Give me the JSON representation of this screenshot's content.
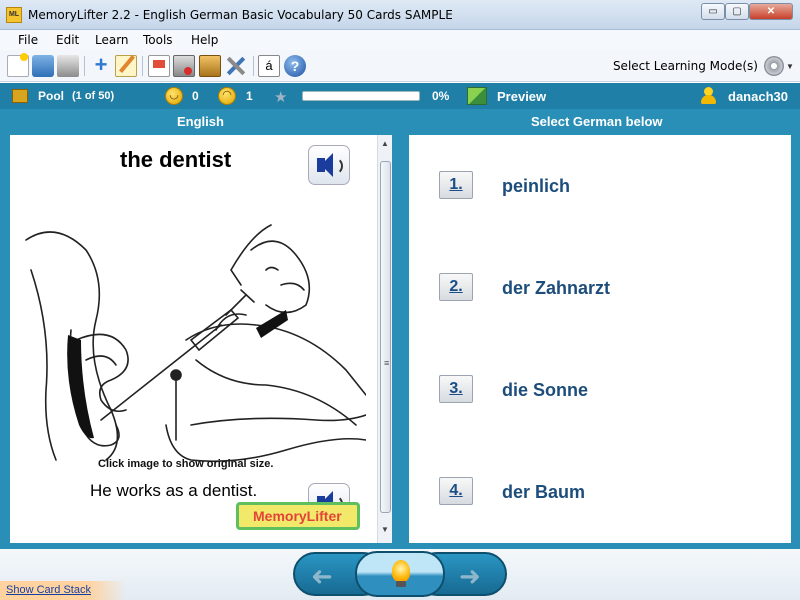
{
  "window": {
    "icon_text": "ML",
    "title": "MemoryLifter 2.2 - English German Basic Vocabulary 50 Cards SAMPLE",
    "buttons": {
      "minimize": "▭",
      "maximize": "▢",
      "close": "✕"
    }
  },
  "menu": {
    "items": [
      "File",
      "Edit",
      "Learn",
      "Tools",
      "Help"
    ]
  },
  "toolbar": {
    "buttons": [
      {
        "icon": "new-document-icon"
      },
      {
        "icon": "open-folder-icon"
      },
      {
        "icon": "print-icon"
      },
      {
        "icon": "add-card-icon"
      },
      {
        "icon": "edit-card-icon"
      },
      {
        "icon": "presentation-icon"
      },
      {
        "icon": "card-stack-icon"
      },
      {
        "icon": "dictionary-icon"
      },
      {
        "icon": "tools-icon"
      },
      {
        "icon": "special-character-icon",
        "label": "á"
      },
      {
        "icon": "help-icon",
        "label": "?"
      }
    ],
    "learning_mode_label": "Select Learning Mode(s)"
  },
  "status": {
    "pool_label": "Pool",
    "pool_count": "(1 of 50)",
    "correct_count": "0",
    "wrong_count": "1",
    "progress_percent": 0,
    "progress_text": "0%",
    "preview_label": "Preview",
    "username": "danach30",
    "accent": "#1f7fa7"
  },
  "question": {
    "language": "English",
    "word": "the dentist",
    "image_caption": "Click image to show original size.",
    "example_sentence": "He works as a dentist.",
    "logo_text": "MemoryLifter"
  },
  "answers": {
    "header": "Select German below",
    "options": [
      {
        "number": "1.",
        "text": "peinlich"
      },
      {
        "number": "2.",
        "text": "der Zahnarzt"
      },
      {
        "number": "3.",
        "text": "die Sonne"
      },
      {
        "number": "4.",
        "text": "der Baum"
      }
    ]
  },
  "nav": {
    "previous_icon": "➜",
    "next_icon": "➜",
    "show_card_stack": "Show Card Stack"
  }
}
